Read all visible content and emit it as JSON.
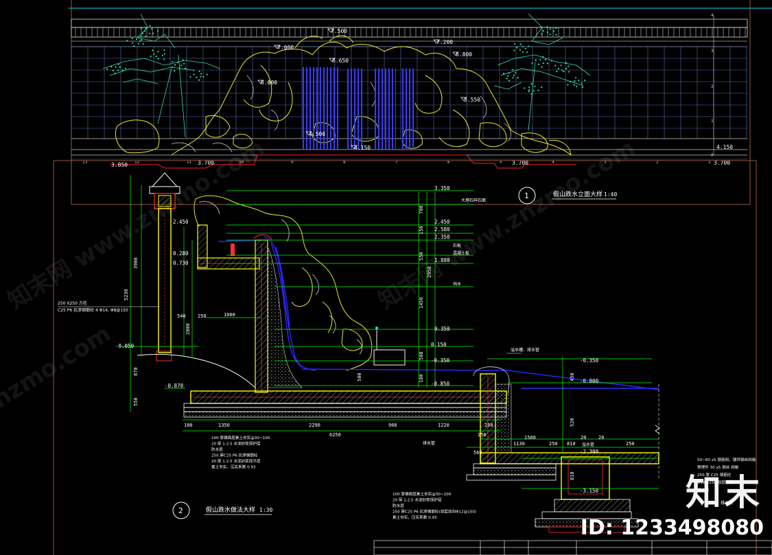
{
  "elevation": {
    "levels": [
      "7.500",
      "7.200",
      "7.000",
      "6.800",
      "6.650",
      "6.000",
      "5.550",
      "4.500",
      "4.150",
      "4.150"
    ],
    "ground_levels": [
      "3.850",
      "3.700",
      "3.700",
      "3.700"
    ],
    "grid_numbers": [
      "13",
      "12",
      "11",
      "10",
      "9",
      "8",
      "7",
      "6",
      "5",
      "4",
      "3",
      "2",
      "1"
    ],
    "title": "假山跌水立面大样",
    "scale": "1:40",
    "number": "1"
  },
  "section": {
    "title": "假山跌水做法大样",
    "scale": "1:30",
    "number": "2",
    "levels_right": [
      "3.350",
      "2.450",
      "2.580",
      "2.350",
      "1.880",
      "0.350",
      "0.150",
      "-0.350",
      "-0.850",
      "-0.350",
      "-0.800",
      "-2.300",
      "-3.150"
    ],
    "levels_left": [
      "2.450",
      "0.280",
      "0.730",
      "-0.050",
      "-0.870"
    ],
    "dims_vertical": [
      "3900",
      "5230",
      "2800",
      "870",
      "550",
      "700",
      "150",
      "550",
      "2950",
      "1450",
      "500",
      "100",
      "520",
      "450",
      "500",
      "810"
    ],
    "dims_horizontal": [
      "100",
      "1350",
      "2290",
      "900",
      "1220",
      "6250",
      "250",
      "250",
      "560",
      "1500",
      "20",
      "20",
      "250",
      "250",
      "810",
      "1130"
    ],
    "labels_left": [
      "250 X250 方柱",
      "C25 P6 抗渗钢筋砼 4 Φ14, Φ8@150"
    ],
    "labels_right_small": [
      "大理石碎石面",
      "石板",
      "混凝土板",
      "挡水",
      "溢水槽、排水管"
    ],
    "construction_left": [
      "100 厚铺面层素土夯实@30~100",
      "20 厚 1:2.5 水泥砂浆保护层",
      "防水层",
      "250 厚C25 P6 抗渗钢筋砼",
      "20 厚 1:2.5 水泥砂浆找平层",
      "素土夯实，压实系数 0.93"
    ],
    "construction_right": [
      "100 厚铺面层素土夯实@30~100",
      "20 厚 1:2.5 水泥砂浆保护层",
      "防水层",
      "250 厚C25 P6 抗渗钢筋砼(双层双向Φ12@150)",
      "素土夯实，压实系数 0.93"
    ],
    "notes_far_right": [
      "50~60 x5 钢筋网，镀锌钢丝网格",
      "预埋件 30 x5 钢丝 网格",
      "250 厚 C25 钢筋砼",
      "Φ12@150 双层双向",
      "滤水网"
    ],
    "misc": [
      "溢水管",
      "排水管",
      "排水沟",
      "1000",
      "540",
      "250",
      "900"
    ]
  },
  "watermarks": [
    "知末网 www.znzmo.com",
    "znzmo.com",
    "知末网 www.znzmo.com"
  ],
  "brand": "知末",
  "id_text": "ID: 1233498080",
  "colors": {
    "background": "#000000",
    "line_white": "#ffffff",
    "line_yellow": "#ffff00",
    "line_red": "#ff0000",
    "line_green": "#00ff00",
    "line_cyan": "#00e5ff",
    "line_blue": "#1818ff",
    "line_magenta": "#ff00ff",
    "tree": "#38e0a8",
    "frame": "#9a5a40"
  }
}
